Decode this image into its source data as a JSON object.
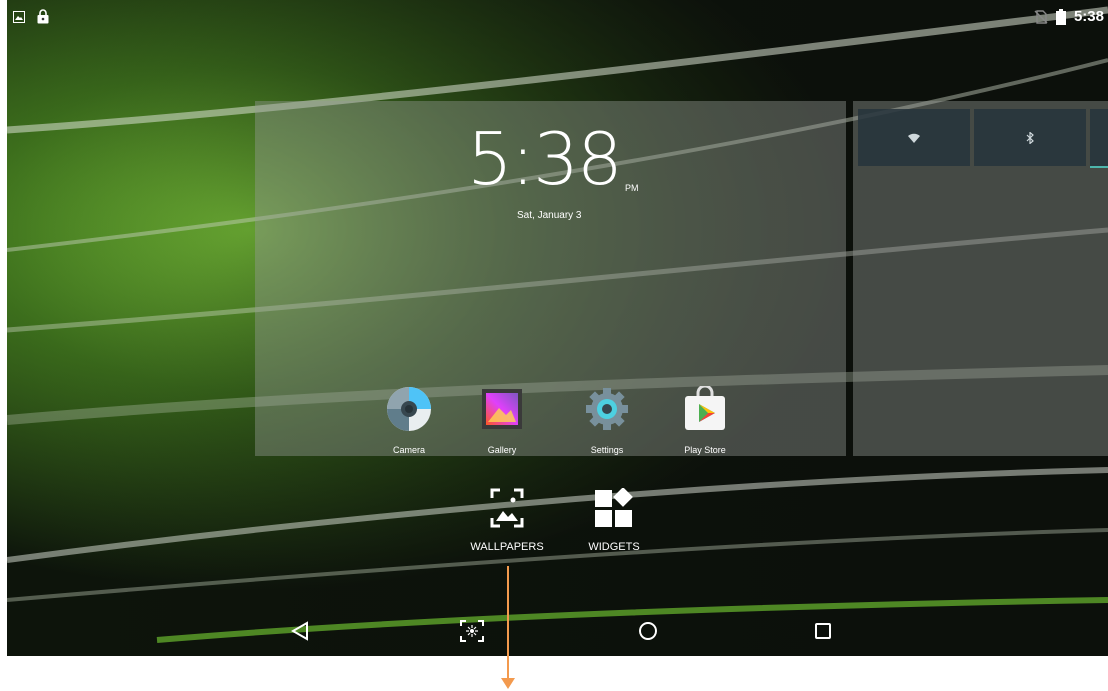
{
  "status_bar": {
    "left_icons": [
      "picture-notification-icon",
      "lock-icon"
    ],
    "right_icons": [
      "no-sim-icon",
      "battery-icon"
    ],
    "time": "5:38"
  },
  "clock_widget": {
    "time": "5:38",
    "ampm": "PM",
    "date": "Sat, January 3"
  },
  "quick_settings": {
    "tiles": [
      "wifi-icon",
      "bluetooth-icon"
    ]
  },
  "apps": [
    {
      "label": "Camera",
      "icon": "camera-icon"
    },
    {
      "label": "Gallery",
      "icon": "gallery-icon"
    },
    {
      "label": "Settings",
      "icon": "settings-icon"
    },
    {
      "label": "Play Store",
      "icon": "play-store-icon"
    }
  ],
  "overview_options": {
    "wallpapers_label": "WALLPAPERS",
    "widgets_label": "WIDGETS"
  },
  "nav_bar": {
    "buttons": [
      "back-icon",
      "screenshot-icon",
      "home-icon",
      "recents-icon"
    ]
  },
  "colors": {
    "accent_arrow": "#f39a4e",
    "quick_tile": "#26343c",
    "wallpaper_green": "#5fa52a"
  }
}
